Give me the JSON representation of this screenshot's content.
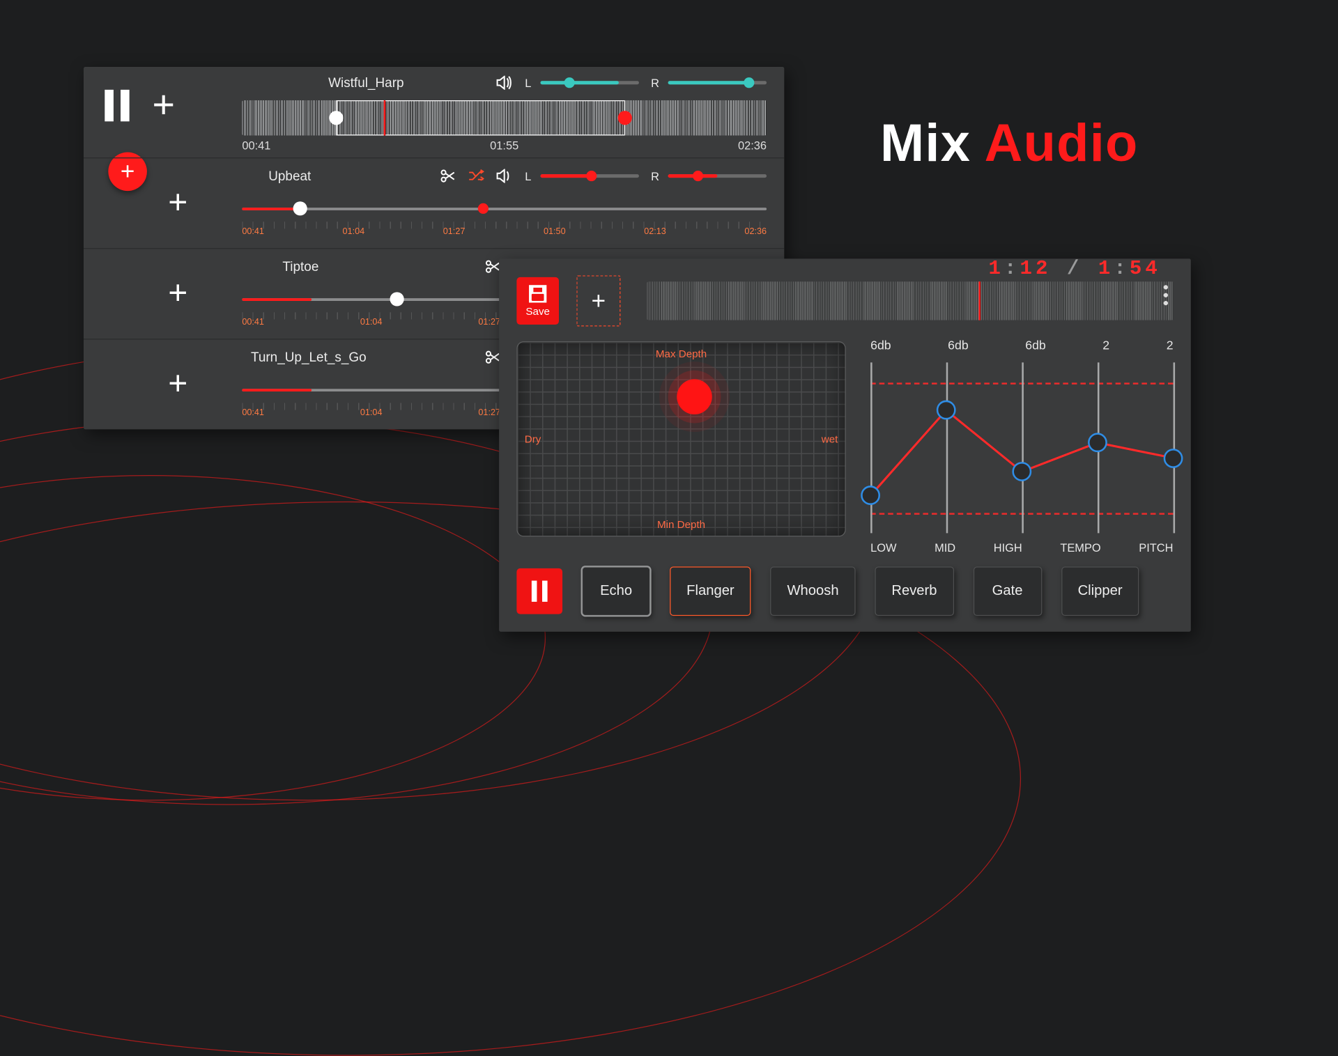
{
  "hero": {
    "word1": "Mix",
    "word2": "Audio"
  },
  "tracks": [
    {
      "name": "Wistful_Harp",
      "has_scissors": false,
      "has_shuffle": false,
      "pan": {
        "L": "L",
        "R": "R"
      },
      "times": {
        "start": "00:41",
        "mid": "01:55",
        "end": "02:36"
      },
      "ruler": null
    },
    {
      "name": "Upbeat",
      "has_scissors": true,
      "has_shuffle": true,
      "pan": {
        "L": "L",
        "R": "R"
      },
      "ruler": [
        "00:41",
        "01:04",
        "01:27",
        "01:50",
        "02:13",
        "02:36"
      ]
    },
    {
      "name": "Tiptoe",
      "has_scissors": true,
      "has_shuffle": false,
      "ruler": [
        "00:41",
        "01:04",
        "01:27"
      ]
    },
    {
      "name": "Turn_Up_Let_s_Go",
      "has_scissors": true,
      "has_shuffle": false,
      "ruler": [
        "00:41",
        "01:04",
        "01:27"
      ]
    }
  ],
  "fx": {
    "save_label": "Save",
    "time": {
      "cur_m": "1",
      "cur_s": "12",
      "tot_m": "1",
      "tot_s": "54",
      "colon": ":",
      "slash": "/"
    },
    "pad": {
      "top": "Max Depth",
      "bottom": "Min Depth",
      "left": "Dry",
      "right": "wet"
    },
    "eq": {
      "top": [
        "6db",
        "6db",
        "6db",
        "2",
        "2"
      ],
      "bottom": [
        "LOW",
        "MID",
        "HIGH",
        "TEMPO",
        "PITCH"
      ],
      "values_pct": [
        78,
        28,
        64,
        47,
        56
      ]
    },
    "buttons": [
      "Echo",
      "Flanger",
      "Whoosh",
      "Reverb",
      "Gate",
      "Clipper"
    ],
    "selected": "Echo",
    "active": "Flanger"
  }
}
